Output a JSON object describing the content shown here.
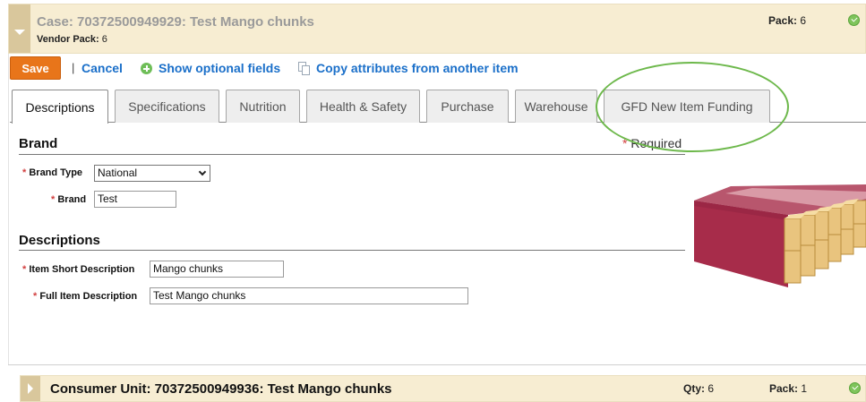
{
  "case": {
    "title": "Case: 70372500949929: Test Mango chunks",
    "vendor_pack_label": "Vendor Pack:",
    "vendor_pack_value": "6",
    "pack_label": "Pack:",
    "pack_value": "6"
  },
  "toolbar": {
    "save_label": "Save",
    "separator": "|",
    "cancel_label": "Cancel",
    "optional_fields_label": "Show optional fields",
    "copy_attributes_label": "Copy attributes from another item"
  },
  "tabs": [
    {
      "label": "Descriptions",
      "active": true
    },
    {
      "label": "Specifications",
      "active": false
    },
    {
      "label": "Nutrition",
      "active": false
    },
    {
      "label": "Health & Safety",
      "active": false
    },
    {
      "label": "Purchase",
      "active": false
    },
    {
      "label": "Warehouse",
      "active": false
    },
    {
      "label": "GFD New Item Funding",
      "active": false
    }
  ],
  "required_note": {
    "star": "*",
    "text": "Required"
  },
  "brand_section": {
    "title": "Brand",
    "brand_type_label": "Brand Type",
    "brand_type_value": "National",
    "brand_label": "Brand",
    "brand_value": "Test"
  },
  "descriptions_section": {
    "title": "Descriptions",
    "short_desc_label": "Item Short Description",
    "short_desc_value": "Mango chunks",
    "full_desc_label": "Full Item Description",
    "full_desc_value": "Test Mango chunks"
  },
  "consumer_unit": {
    "title": "Consumer Unit: 70372500949936: Test Mango chunks",
    "qty_label": "Qty:",
    "qty_value": "6",
    "pack_label": "Pack:",
    "pack_value": "1"
  },
  "colors": {
    "accent_orange": "#e8751a",
    "link_blue": "#1a6fc9",
    "header_bg": "#f7edd2",
    "highlight_green": "#6db84b",
    "required_red": "#d24040"
  },
  "icons": {
    "case_toggle": "chevron-down-icon",
    "status": "check-circle-icon",
    "optional_fields": "plus-circle-icon",
    "copy": "copy-icon",
    "cu_toggle": "chevron-right-icon"
  }
}
